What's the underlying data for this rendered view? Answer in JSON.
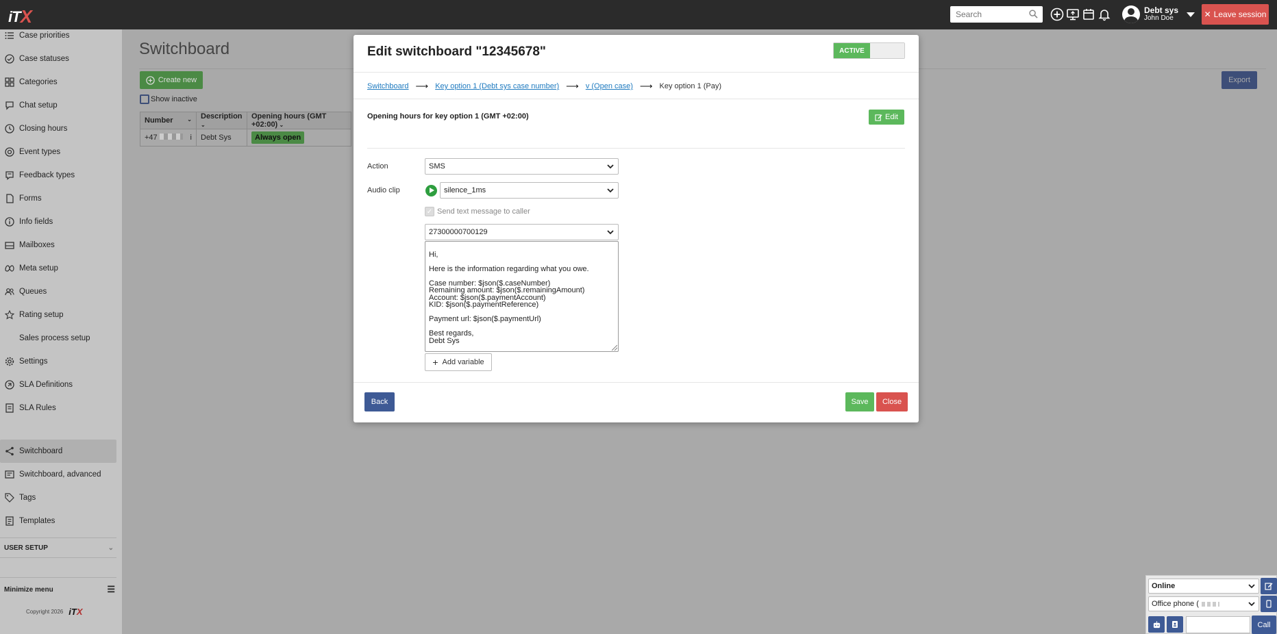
{
  "app": {
    "logo": "iTX"
  },
  "topbar": {
    "search_placeholder": "Search",
    "user_name": "Debt sys",
    "user_subname": "John Doe",
    "leave_label": "Leave session"
  },
  "sidebar": {
    "items": [
      {
        "label": "Case priorities",
        "icon": "list-icon"
      },
      {
        "label": "Case statuses",
        "icon": "check-circle-icon"
      },
      {
        "label": "Categories",
        "icon": "grid-icon"
      },
      {
        "label": "Chat setup",
        "icon": "chat-icon"
      },
      {
        "label": "Closing hours",
        "icon": "clock-icon"
      },
      {
        "label": "Event types",
        "icon": "target-icon"
      },
      {
        "label": "Feedback types",
        "icon": "feedback-icon"
      },
      {
        "label": "Forms",
        "icon": "document-icon"
      },
      {
        "label": "Info fields",
        "icon": "info-icon"
      },
      {
        "label": "Mailboxes",
        "icon": "mailbox-icon"
      },
      {
        "label": "Meta setup",
        "icon": "meta-icon"
      },
      {
        "label": "Queues",
        "icon": "users-icon"
      },
      {
        "label": "Rating setup",
        "icon": "star-icon"
      },
      {
        "label": "Sales process setup",
        "icon": ""
      },
      {
        "label": "Settings",
        "icon": "gear-icon"
      },
      {
        "label": "SLA Definitions",
        "icon": "sla-icon"
      },
      {
        "label": "SLA Rules",
        "icon": "rules-icon"
      },
      {
        "label": "Switchboard",
        "icon": "share-icon"
      },
      {
        "label": "Switchboard, advanced",
        "icon": "switchboard-advanced-icon"
      },
      {
        "label": "Tags",
        "icon": "tag-icon"
      },
      {
        "label": "Templates",
        "icon": "template-icon"
      }
    ],
    "user_setup": "USER SETUP",
    "minimize": "Minimize menu",
    "copyright": "Copyright 2026"
  },
  "page": {
    "title": "Switchboard",
    "create_label": "Create new",
    "export_label": "Export",
    "show_inactive": "Show inactive",
    "table": {
      "headers": [
        "Number",
        "Description",
        "Opening hours (GMT +02:00)"
      ],
      "row": {
        "number": "+47",
        "description": "Debt Sys",
        "hours": "Always open"
      }
    }
  },
  "modal": {
    "title": "Edit switchboard \"12345678\"",
    "status": "ACTIVE",
    "breadcrumb": {
      "c1": "Switchboard",
      "c2": "Key option 1 (Debt sys case number)",
      "c3": "v (Open case)",
      "c4": "Key option 1 (Pay)"
    },
    "opening_hours": "Opening hours for key option 1 (GMT +02:00)",
    "edit_label": "Edit",
    "action_label": "Action",
    "action_value": "SMS",
    "audio_label": "Audio clip",
    "audio_value": "silence_1ms",
    "send_sms_label": "Send text message to caller",
    "sender_value": "27300000700129",
    "message": "Hi,\n\nHere is the information regarding what you owe.\n\nCase number: $json($.caseNumber)\nRemaining amount: $json($.remainingAmount)\nAccount: $json($.paymentAccount)\nKID: $json($.paymentReference)\n\nPayment url: $json($.paymentUrl)\n\nBest regards,\nDebt Sys",
    "add_variable": "Add variable",
    "back_label": "Back",
    "save_label": "Save",
    "close_label": "Close"
  },
  "phone": {
    "status": "Online",
    "device": "Office phone (",
    "call_label": "Call"
  },
  "colors": {
    "green": "#5cb85c",
    "red": "#d9534f",
    "navy": "#3e5a95",
    "link": "#1e7abf"
  }
}
